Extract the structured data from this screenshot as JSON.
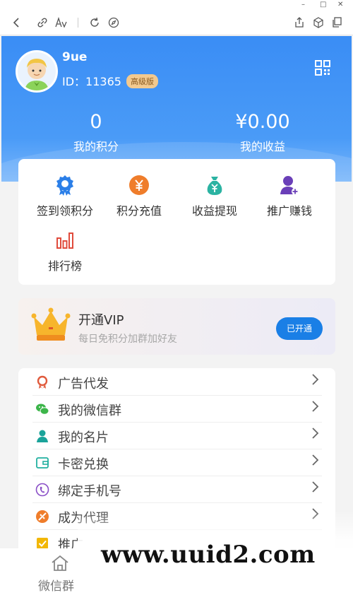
{
  "window": {
    "minimize": "–",
    "maximize": "□",
    "close": "✕"
  },
  "toolbar": {
    "icons": [
      "back-icon",
      "link-icon",
      "read-aloud-icon",
      "refresh-icon",
      "compass-icon",
      "share-icon",
      "cube-icon",
      "copy-icon"
    ]
  },
  "profile": {
    "username": "9ue",
    "id_label": "ID：11365",
    "tier_badge": "高级版"
  },
  "stats": [
    {
      "value": "0",
      "label": "我的积分"
    },
    {
      "value": "¥0.00",
      "label": "我的收益"
    }
  ],
  "grid": [
    {
      "label": "签到领积分",
      "icon": "badge-icon",
      "color": "#2b7fe8"
    },
    {
      "label": "积分充值",
      "icon": "yen-coin-icon",
      "color": "#ef7d2b"
    },
    {
      "label": "收益提现",
      "icon": "money-bag-icon",
      "color": "#2bb3a2"
    },
    {
      "label": "推广赚钱",
      "icon": "add-user-icon",
      "color": "#6a3fb8"
    },
    {
      "label": "排行榜",
      "icon": "bar-chart-icon",
      "color": "#e04b3c"
    }
  ],
  "vip": {
    "title": "开通VIP",
    "subtitle": "每日免积分加群加好友",
    "button": "已开通"
  },
  "menu": [
    {
      "label": "广告代发",
      "icon": "ribbon-icon",
      "color": "#e05a3c"
    },
    {
      "label": "我的微信群",
      "icon": "wechat-icon",
      "color": "#3cb54a"
    },
    {
      "label": "我的名片",
      "icon": "person-icon",
      "color": "#1aa39a"
    },
    {
      "label": "卡密兑换",
      "icon": "wallet-icon",
      "color": "#22b0a0"
    },
    {
      "label": "绑定手机号",
      "icon": "phone-icon",
      "color": "#8a4fc7"
    },
    {
      "label": "成为代理",
      "icon": "agent-icon",
      "color": "#ef7d2b"
    },
    {
      "label": "推广",
      "icon": "checkbox-icon",
      "color": "#f2b705"
    }
  ],
  "nav": {
    "home_label": "微信群"
  },
  "watermark": "www.uuid2.com",
  "colors": {
    "primary": "#3a8df5",
    "vip_button": "#1a7fe6"
  }
}
